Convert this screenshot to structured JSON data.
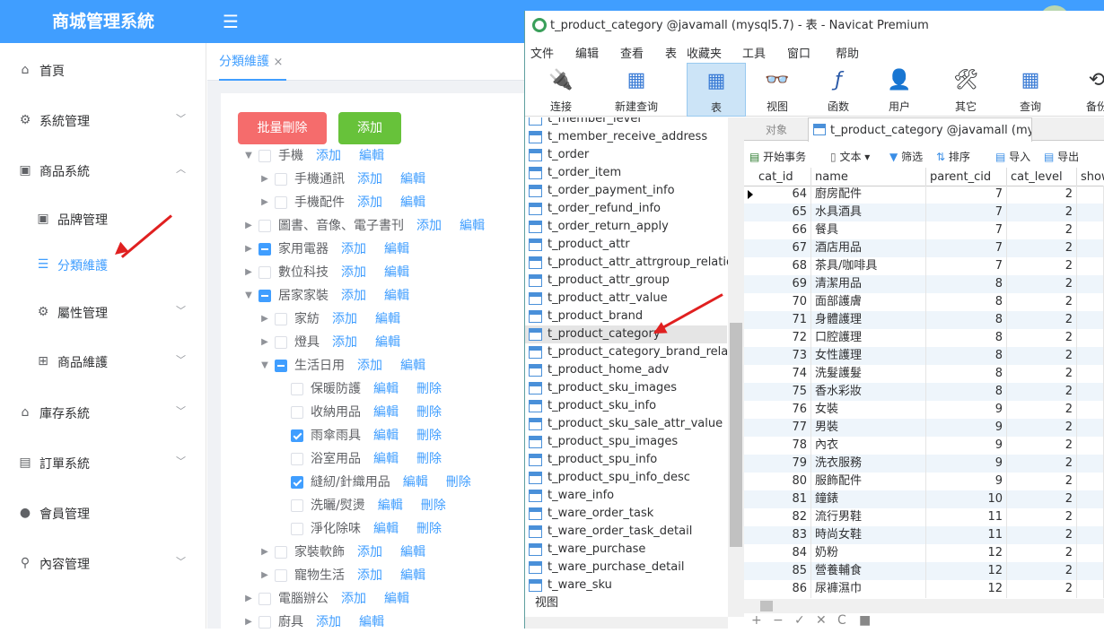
{
  "app": {
    "title": "商城管理系統",
    "hamburger": "☰"
  },
  "sidebar": {
    "items": [
      {
        "label": "首頁",
        "icon": "home-icon",
        "glyph": "⌂"
      },
      {
        "label": "系統管理",
        "icon": "gear-icon",
        "glyph": "⚙"
      },
      {
        "label": "商品系統",
        "icon": "goods-icon",
        "glyph": "▣"
      },
      {
        "label": "品牌管理",
        "icon": "brand-icon",
        "glyph": "▣"
      },
      {
        "label": "分類維護",
        "icon": "list-icon",
        "glyph": "☰"
      },
      {
        "label": "屬性管理",
        "icon": "gear-icon",
        "glyph": "⚙"
      },
      {
        "label": "商品維護",
        "icon": "grid-icon",
        "glyph": "⊞"
      },
      {
        "label": "庫存系統",
        "icon": "home-icon",
        "glyph": "⌂"
      },
      {
        "label": "訂單系統",
        "icon": "order-icon",
        "glyph": "▤"
      },
      {
        "label": "會員管理",
        "icon": "user-icon",
        "glyph": "●"
      },
      {
        "label": "內容管理",
        "icon": "search-icon",
        "glyph": "⚲"
      }
    ]
  },
  "tabs": {
    "active": "分類維護",
    "close": "×"
  },
  "buttons": {
    "batch_delete": "批量刪除",
    "add": "添加"
  },
  "tree": {
    "add": "添加",
    "edit": "編輯",
    "delete": "刪除",
    "nodes": [
      {
        "label": "手機",
        "check": "none",
        "expanded": true,
        "level": 0,
        "actions": [
          "add",
          "edit"
        ]
      },
      {
        "label": "手機通訊",
        "check": "none",
        "expanded": false,
        "level": 1,
        "actions": [
          "add",
          "edit"
        ]
      },
      {
        "label": "手機配件",
        "check": "none",
        "expanded": false,
        "level": 1,
        "actions": [
          "add",
          "edit"
        ]
      },
      {
        "label": "圖書、音像、電子書刊",
        "check": "none",
        "expanded": false,
        "level": 0,
        "actions": [
          "add",
          "edit"
        ]
      },
      {
        "label": "家用電器",
        "check": "indeterminate",
        "expanded": false,
        "level": 0,
        "actions": [
          "add",
          "edit"
        ]
      },
      {
        "label": "數位科技",
        "check": "none",
        "expanded": false,
        "level": 0,
        "actions": [
          "add",
          "edit"
        ]
      },
      {
        "label": "居家家裝",
        "check": "indeterminate",
        "expanded": true,
        "level": 0,
        "actions": [
          "add",
          "edit"
        ]
      },
      {
        "label": "家紡",
        "check": "none",
        "expanded": false,
        "level": 1,
        "actions": [
          "add",
          "edit"
        ]
      },
      {
        "label": "燈具",
        "check": "none",
        "expanded": false,
        "level": 1,
        "actions": [
          "add",
          "edit"
        ]
      },
      {
        "label": "生活日用",
        "check": "indeterminate",
        "expanded": true,
        "level": 1,
        "actions": [
          "add",
          "edit"
        ]
      },
      {
        "label": "保暖防護",
        "check": "none",
        "leaf": true,
        "level": 2,
        "actions": [
          "edit",
          "delete"
        ]
      },
      {
        "label": "收納用品",
        "check": "none",
        "leaf": true,
        "level": 2,
        "actions": [
          "edit",
          "delete"
        ]
      },
      {
        "label": "雨傘雨具",
        "check": "checked",
        "leaf": true,
        "level": 2,
        "actions": [
          "edit",
          "delete"
        ]
      },
      {
        "label": "浴室用品",
        "check": "none",
        "leaf": true,
        "level": 2,
        "actions": [
          "edit",
          "delete"
        ]
      },
      {
        "label": "縫紉/針織用品",
        "check": "checked",
        "leaf": true,
        "level": 2,
        "actions": [
          "edit",
          "delete"
        ]
      },
      {
        "label": "洗曬/熨燙",
        "check": "none",
        "leaf": true,
        "level": 2,
        "actions": [
          "edit",
          "delete"
        ]
      },
      {
        "label": "淨化除味",
        "check": "none",
        "leaf": true,
        "level": 2,
        "actions": [
          "edit",
          "delete"
        ]
      },
      {
        "label": "家裝軟飾",
        "check": "none",
        "expanded": false,
        "level": 1,
        "actions": [
          "add",
          "edit"
        ]
      },
      {
        "label": "寵物生活",
        "check": "none",
        "expanded": false,
        "level": 1,
        "actions": [
          "add",
          "edit"
        ]
      },
      {
        "label": "電腦辦公",
        "check": "none",
        "expanded": false,
        "level": 0,
        "actions": [
          "add",
          "edit"
        ]
      },
      {
        "label": "廚具",
        "check": "none",
        "expanded": false,
        "level": 0,
        "actions": [
          "add",
          "edit"
        ]
      }
    ]
  },
  "navicat": {
    "title": "t_product_category @javamall (mysql5.7) - 表 - Navicat Premium",
    "menu": [
      "文件",
      "编辑",
      "查看",
      "表",
      "收藏夹",
      "工具",
      "窗口",
      "帮助"
    ],
    "toolbar": [
      {
        "label": "连接",
        "icon": "plug-icon",
        "glyph": "🔌"
      },
      {
        "label": "新建查询",
        "icon": "new-query-icon",
        "glyph": "▦"
      },
      {
        "label": "表",
        "icon": "table-icon",
        "glyph": "▦"
      },
      {
        "label": "视图",
        "icon": "view-icon",
        "glyph": "👓"
      },
      {
        "label": "函数",
        "icon": "function-icon",
        "glyph": "ƒ"
      },
      {
        "label": "用户",
        "icon": "user-icon",
        "glyph": "👤"
      },
      {
        "label": "其它",
        "icon": "tools-icon",
        "glyph": "🛠"
      },
      {
        "label": "查询",
        "icon": "query-icon",
        "glyph": "▦"
      },
      {
        "label": "备份",
        "icon": "backup-icon",
        "glyph": "⟲"
      }
    ],
    "tables": [
      "t_member_level",
      "t_member_receive_address",
      "t_order",
      "t_order_item",
      "t_order_payment_info",
      "t_order_refund_info",
      "t_order_return_apply",
      "t_product_attr",
      "t_product_attr_attrgroup_relation",
      "t_product_attr_group",
      "t_product_attr_value",
      "t_product_brand",
      "t_product_category",
      "t_product_category_brand_relation",
      "t_product_home_adv",
      "t_product_sku_images",
      "t_product_sku_info",
      "t_product_sku_sale_attr_value",
      "t_product_spu_images",
      "t_product_spu_info",
      "t_product_spu_info_desc",
      "t_ware_info",
      "t_ware_order_task",
      "t_ware_order_task_detail",
      "t_ware_purchase",
      "t_ware_purchase_detail",
      "t_ware_sku"
    ],
    "selected_table": "t_product_category",
    "views_label": "视图",
    "obj_tab": "对象",
    "table_tab": "t_product_category @javamall (mysql...",
    "grid_toolbar": {
      "begin_tx": "开始事务",
      "text": "文本",
      "filter": "筛选",
      "sort": "排序",
      "import": "导入",
      "export": "导出"
    },
    "columns": [
      "cat_id",
      "name",
      "parent_cid",
      "cat_level",
      "show"
    ],
    "rows": [
      [
        "64",
        "廚房配件",
        "7",
        "2"
      ],
      [
        "65",
        "水具酒具",
        "7",
        "2"
      ],
      [
        "66",
        "餐具",
        "7",
        "2"
      ],
      [
        "67",
        "酒店用品",
        "7",
        "2"
      ],
      [
        "68",
        "茶具/咖啡具",
        "7",
        "2"
      ],
      [
        "69",
        "清潔用品",
        "8",
        "2"
      ],
      [
        "70",
        "面部護膚",
        "8",
        "2"
      ],
      [
        "71",
        "身體護理",
        "8",
        "2"
      ],
      [
        "72",
        "口腔護理",
        "8",
        "2"
      ],
      [
        "73",
        "女性護理",
        "8",
        "2"
      ],
      [
        "74",
        "洗髮護髮",
        "8",
        "2"
      ],
      [
        "75",
        "香水彩妝",
        "8",
        "2"
      ],
      [
        "76",
        "女裝",
        "9",
        "2"
      ],
      [
        "77",
        "男裝",
        "9",
        "2"
      ],
      [
        "78",
        "內衣",
        "9",
        "2"
      ],
      [
        "79",
        "洗衣服務",
        "9",
        "2"
      ],
      [
        "80",
        "服飾配件",
        "9",
        "2"
      ],
      [
        "81",
        "鐘錶",
        "10",
        "2"
      ],
      [
        "82",
        "流行男鞋",
        "11",
        "2"
      ],
      [
        "83",
        "時尚女鞋",
        "11",
        "2"
      ],
      [
        "84",
        "奶粉",
        "12",
        "2"
      ],
      [
        "85",
        "營養輔食",
        "12",
        "2"
      ],
      [
        "86",
        "尿褲濕巾",
        "12",
        "2"
      ]
    ],
    "bottom": [
      "+",
      "−",
      "✓",
      "✕",
      "C",
      "■"
    ]
  }
}
